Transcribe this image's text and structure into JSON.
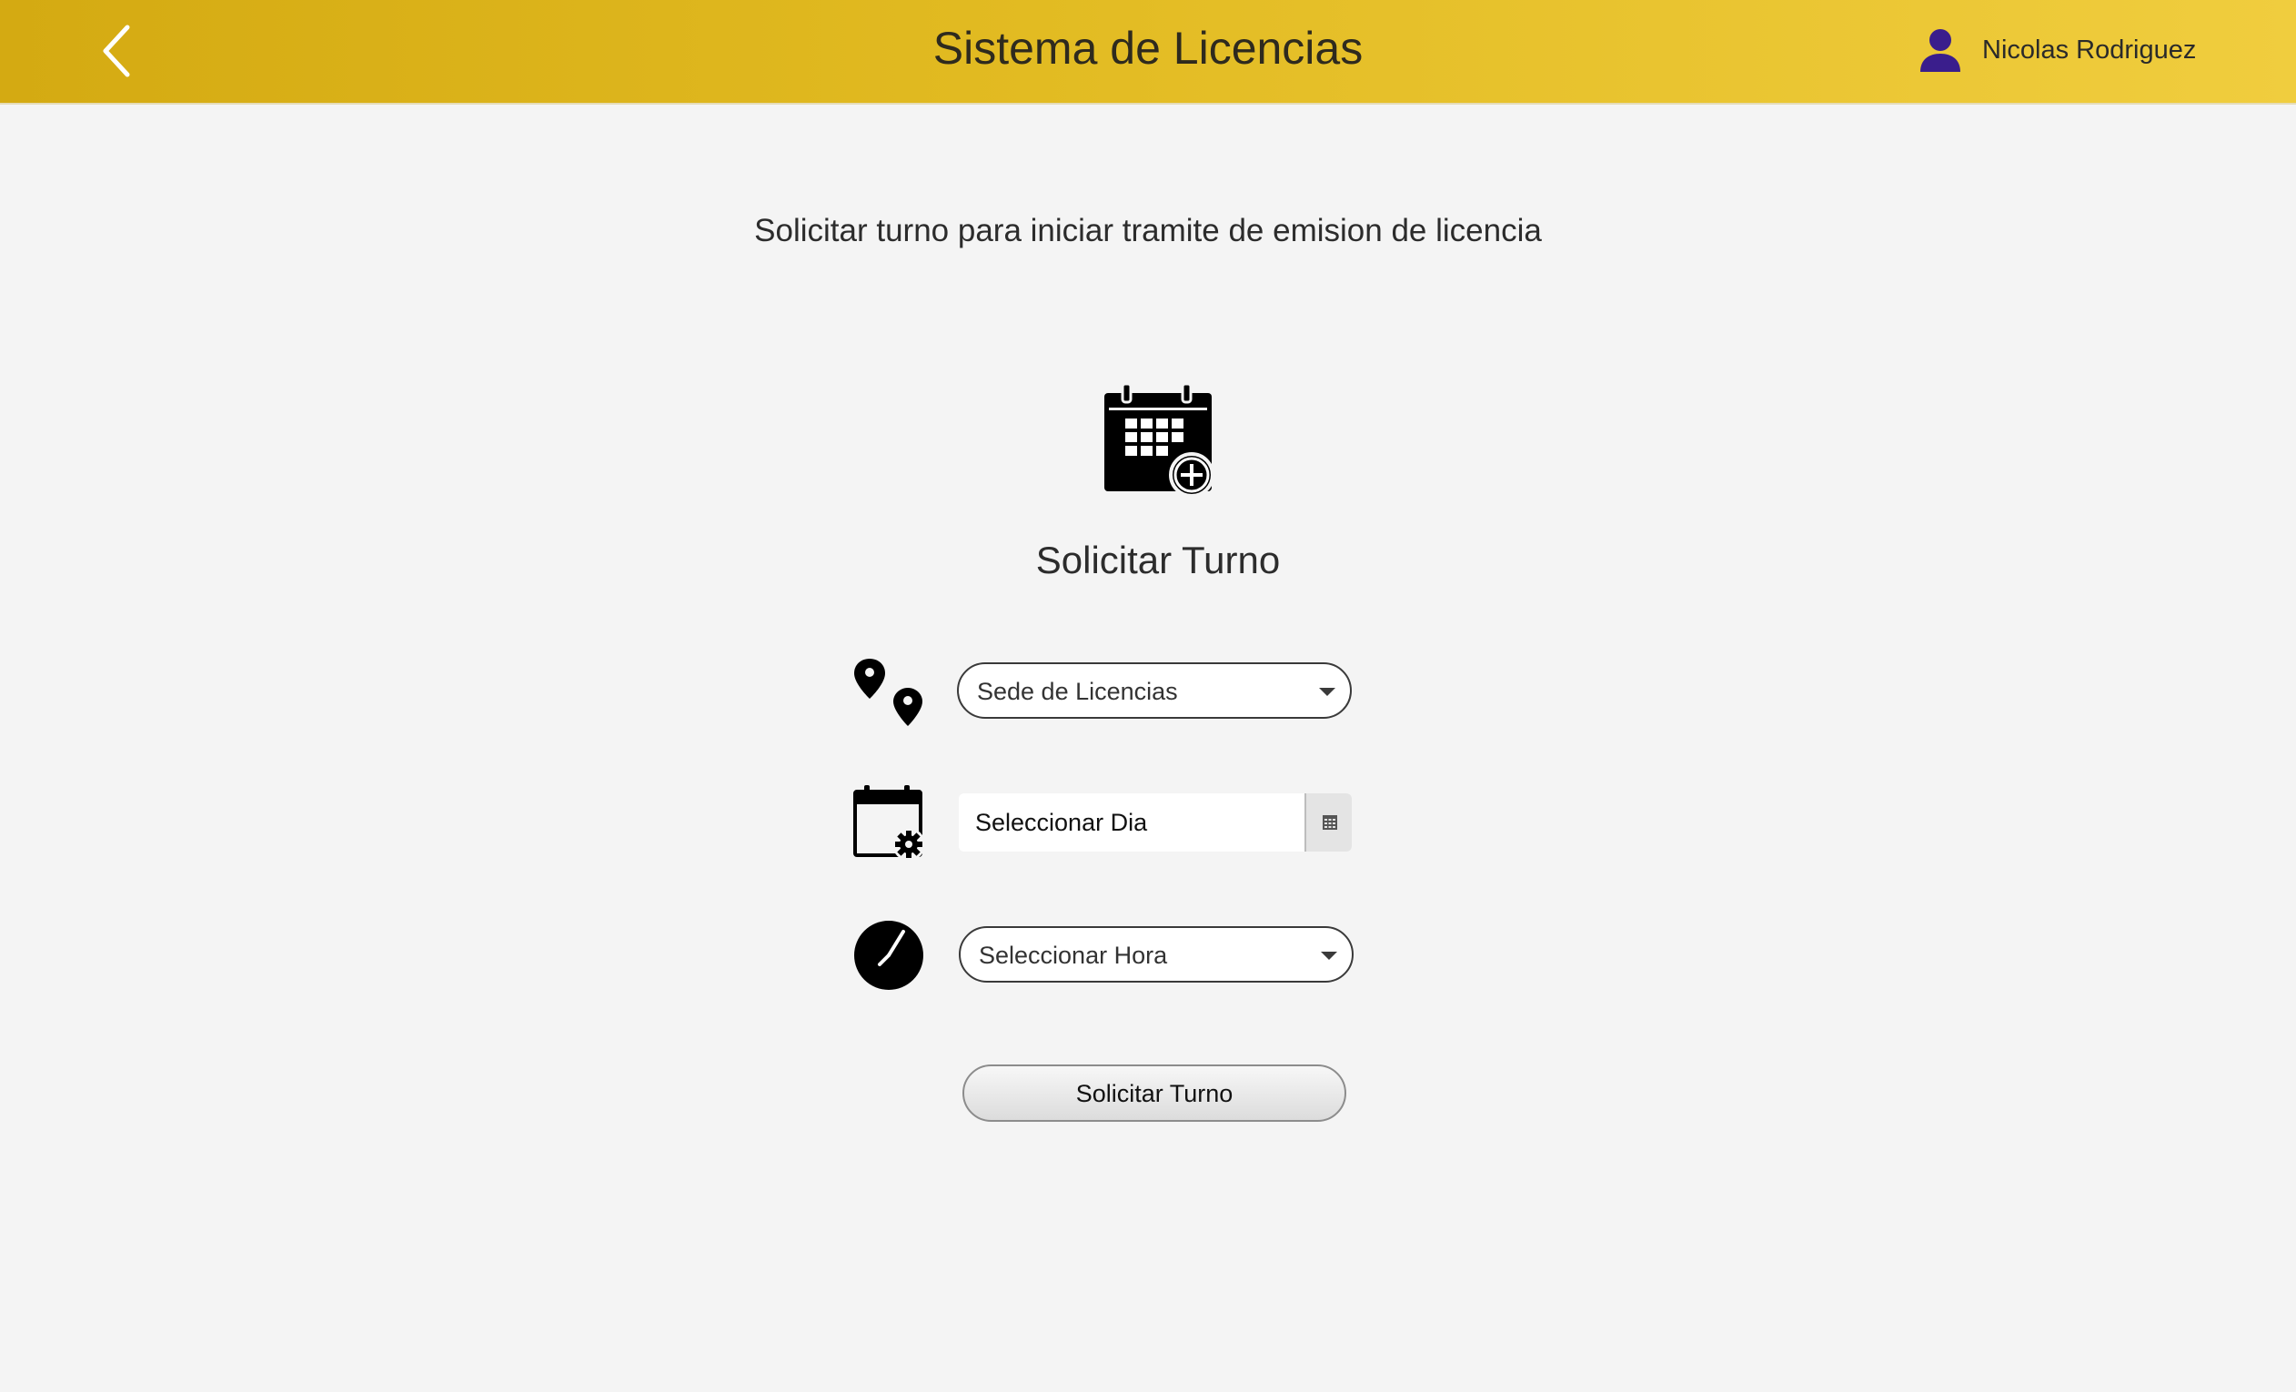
{
  "header": {
    "title": "Sistema de Licencias",
    "user_name": "Nicolas Rodriguez",
    "back_icon": "chevron-left-icon",
    "user_icon": "user-icon"
  },
  "main": {
    "subtitle": "Solicitar turno para iniciar tramite de emision de licencia",
    "hero_icon": "calendar-add-icon",
    "section_title": "Solicitar Turno",
    "form": {
      "sede": {
        "icon": "map-pins-icon",
        "value": "Sede de Licencias"
      },
      "dia": {
        "icon": "calendar-gear-icon",
        "placeholder": "Seleccionar Dia",
        "button_icon": "calendar-grid-icon"
      },
      "hora": {
        "icon": "clock-icon",
        "value": "Seleccionar Hora"
      },
      "submit_label": "Solicitar Turno"
    }
  },
  "colors": {
    "header_gradient_start": "#d4aa12",
    "header_gradient_end": "#f0cd3e",
    "user_icon": "#3a1e8c",
    "background": "#f4f4f4"
  }
}
